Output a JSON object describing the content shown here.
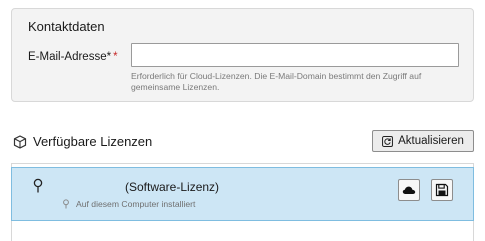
{
  "contact": {
    "title": "Kontaktdaten",
    "email_label": "E-Mail-Adresse*",
    "email_required_marker": "*",
    "email_value": "",
    "hint": "Erforderlich für Cloud-Lizenzen. Die E-Mail-Domain bestimmt den Zugriff auf gemeinsame Lizenzen."
  },
  "licenses": {
    "title": "Verfügbare Lizenzen",
    "refresh_label": "Aktualisieren",
    "items": [
      {
        "name": "(Software-Lizenz)",
        "subtitle": "Auf diesem Computer installiert",
        "selected": true
      }
    ]
  },
  "icons": {
    "section": "package-icon",
    "refresh": "refresh-icon",
    "pin": "pin-icon",
    "cloud": "cloud-icon",
    "save": "save-icon"
  },
  "colors": {
    "selected_bg": "#cde6f5",
    "selected_border": "#7fbde0",
    "required": "#c62828"
  }
}
